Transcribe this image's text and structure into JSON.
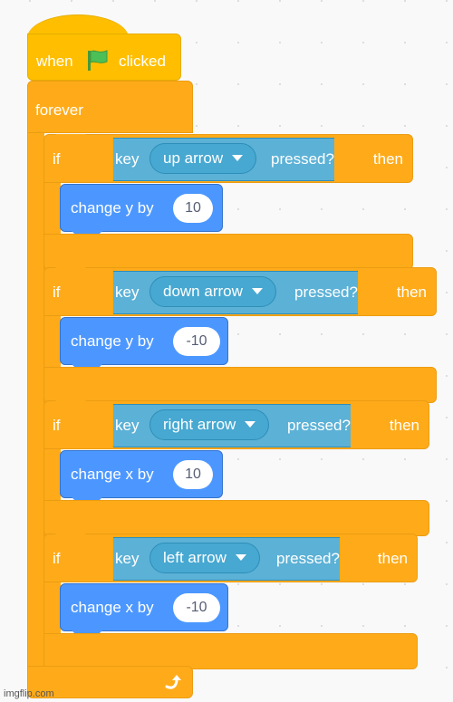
{
  "hat": {
    "when": "when",
    "flag_icon": "green-flag-icon",
    "clicked": "clicked"
  },
  "forever": {
    "label": "forever",
    "loop_icon": "loop-arrow-icon"
  },
  "if_blocks": [
    {
      "if": "if",
      "key": "key",
      "key_option": "up arrow",
      "pressed": "pressed?",
      "then": "then",
      "action": "change y by",
      "value": "10"
    },
    {
      "if": "if",
      "key": "key",
      "key_option": "down arrow",
      "pressed": "pressed?",
      "then": "then",
      "action": "change y by",
      "value": "-10"
    },
    {
      "if": "if",
      "key": "key",
      "key_option": "right arrow",
      "pressed": "pressed?",
      "then": "then",
      "action": "change x by",
      "value": "10"
    },
    {
      "if": "if",
      "key": "key",
      "key_option": "left arrow",
      "pressed": "pressed?",
      "then": "then",
      "action": "change x by",
      "value": "-10"
    }
  ],
  "colors": {
    "events": "#ffbf00",
    "control": "#ffab19",
    "sensing": "#5cb1d6",
    "motion": "#4c97ff",
    "flag": "#4cbf56"
  },
  "watermark": "imgflip.com"
}
